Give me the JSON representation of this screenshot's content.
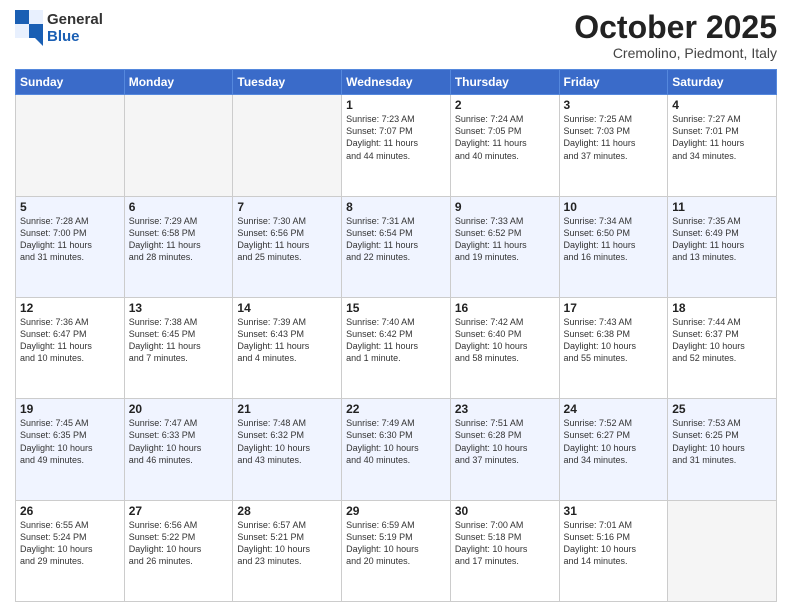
{
  "header": {
    "logo_line1": "General",
    "logo_line2": "Blue",
    "month_title": "October 2025",
    "subtitle": "Cremolino, Piedmont, Italy"
  },
  "days_of_week": [
    "Sunday",
    "Monday",
    "Tuesday",
    "Wednesday",
    "Thursday",
    "Friday",
    "Saturday"
  ],
  "weeks": [
    [
      {
        "day": "",
        "info": ""
      },
      {
        "day": "",
        "info": ""
      },
      {
        "day": "",
        "info": ""
      },
      {
        "day": "1",
        "info": "Sunrise: 7:23 AM\nSunset: 7:07 PM\nDaylight: 11 hours\nand 44 minutes."
      },
      {
        "day": "2",
        "info": "Sunrise: 7:24 AM\nSunset: 7:05 PM\nDaylight: 11 hours\nand 40 minutes."
      },
      {
        "day": "3",
        "info": "Sunrise: 7:25 AM\nSunset: 7:03 PM\nDaylight: 11 hours\nand 37 minutes."
      },
      {
        "day": "4",
        "info": "Sunrise: 7:27 AM\nSunset: 7:01 PM\nDaylight: 11 hours\nand 34 minutes."
      }
    ],
    [
      {
        "day": "5",
        "info": "Sunrise: 7:28 AM\nSunset: 7:00 PM\nDaylight: 11 hours\nand 31 minutes."
      },
      {
        "day": "6",
        "info": "Sunrise: 7:29 AM\nSunset: 6:58 PM\nDaylight: 11 hours\nand 28 minutes."
      },
      {
        "day": "7",
        "info": "Sunrise: 7:30 AM\nSunset: 6:56 PM\nDaylight: 11 hours\nand 25 minutes."
      },
      {
        "day": "8",
        "info": "Sunrise: 7:31 AM\nSunset: 6:54 PM\nDaylight: 11 hours\nand 22 minutes."
      },
      {
        "day": "9",
        "info": "Sunrise: 7:33 AM\nSunset: 6:52 PM\nDaylight: 11 hours\nand 19 minutes."
      },
      {
        "day": "10",
        "info": "Sunrise: 7:34 AM\nSunset: 6:50 PM\nDaylight: 11 hours\nand 16 minutes."
      },
      {
        "day": "11",
        "info": "Sunrise: 7:35 AM\nSunset: 6:49 PM\nDaylight: 11 hours\nand 13 minutes."
      }
    ],
    [
      {
        "day": "12",
        "info": "Sunrise: 7:36 AM\nSunset: 6:47 PM\nDaylight: 11 hours\nand 10 minutes."
      },
      {
        "day": "13",
        "info": "Sunrise: 7:38 AM\nSunset: 6:45 PM\nDaylight: 11 hours\nand 7 minutes."
      },
      {
        "day": "14",
        "info": "Sunrise: 7:39 AM\nSunset: 6:43 PM\nDaylight: 11 hours\nand 4 minutes."
      },
      {
        "day": "15",
        "info": "Sunrise: 7:40 AM\nSunset: 6:42 PM\nDaylight: 11 hours\nand 1 minute."
      },
      {
        "day": "16",
        "info": "Sunrise: 7:42 AM\nSunset: 6:40 PM\nDaylight: 10 hours\nand 58 minutes."
      },
      {
        "day": "17",
        "info": "Sunrise: 7:43 AM\nSunset: 6:38 PM\nDaylight: 10 hours\nand 55 minutes."
      },
      {
        "day": "18",
        "info": "Sunrise: 7:44 AM\nSunset: 6:37 PM\nDaylight: 10 hours\nand 52 minutes."
      }
    ],
    [
      {
        "day": "19",
        "info": "Sunrise: 7:45 AM\nSunset: 6:35 PM\nDaylight: 10 hours\nand 49 minutes."
      },
      {
        "day": "20",
        "info": "Sunrise: 7:47 AM\nSunset: 6:33 PM\nDaylight: 10 hours\nand 46 minutes."
      },
      {
        "day": "21",
        "info": "Sunrise: 7:48 AM\nSunset: 6:32 PM\nDaylight: 10 hours\nand 43 minutes."
      },
      {
        "day": "22",
        "info": "Sunrise: 7:49 AM\nSunset: 6:30 PM\nDaylight: 10 hours\nand 40 minutes."
      },
      {
        "day": "23",
        "info": "Sunrise: 7:51 AM\nSunset: 6:28 PM\nDaylight: 10 hours\nand 37 minutes."
      },
      {
        "day": "24",
        "info": "Sunrise: 7:52 AM\nSunset: 6:27 PM\nDaylight: 10 hours\nand 34 minutes."
      },
      {
        "day": "25",
        "info": "Sunrise: 7:53 AM\nSunset: 6:25 PM\nDaylight: 10 hours\nand 31 minutes."
      }
    ],
    [
      {
        "day": "26",
        "info": "Sunrise: 6:55 AM\nSunset: 5:24 PM\nDaylight: 10 hours\nand 29 minutes."
      },
      {
        "day": "27",
        "info": "Sunrise: 6:56 AM\nSunset: 5:22 PM\nDaylight: 10 hours\nand 26 minutes."
      },
      {
        "day": "28",
        "info": "Sunrise: 6:57 AM\nSunset: 5:21 PM\nDaylight: 10 hours\nand 23 minutes."
      },
      {
        "day": "29",
        "info": "Sunrise: 6:59 AM\nSunset: 5:19 PM\nDaylight: 10 hours\nand 20 minutes."
      },
      {
        "day": "30",
        "info": "Sunrise: 7:00 AM\nSunset: 5:18 PM\nDaylight: 10 hours\nand 17 minutes."
      },
      {
        "day": "31",
        "info": "Sunrise: 7:01 AM\nSunset: 5:16 PM\nDaylight: 10 hours\nand 14 minutes."
      },
      {
        "day": "",
        "info": ""
      }
    ]
  ]
}
